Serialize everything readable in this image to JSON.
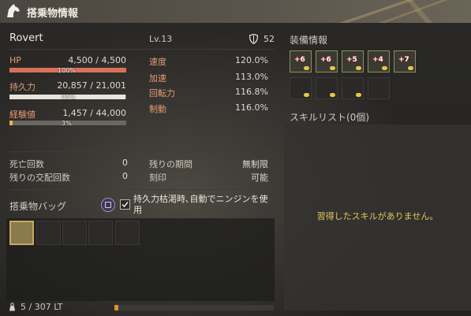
{
  "window": {
    "title": "搭乗物情報"
  },
  "mount": {
    "name": "Rovert",
    "level": "Lv.13",
    "defense": "52"
  },
  "stats": {
    "hp": {
      "label": "HP",
      "value": "4,500 / 4,500",
      "percent_text": "100%",
      "fraction": 1.0,
      "color": "#d9705a"
    },
    "stamina": {
      "label": "持久力",
      "value": "20,857 / 21,001",
      "percent_text": "99%",
      "fraction": 0.99,
      "color": "#e8e4dc"
    },
    "exp": {
      "label": "経験値",
      "value": "1,457 / 44,000",
      "percent_text": "3%",
      "fraction": 0.03,
      "color": "#e6b93c"
    }
  },
  "speed_stats": [
    {
      "label": "速度",
      "value": "120.0%"
    },
    {
      "label": "加速",
      "value": "113.0%"
    },
    {
      "label": "回転力",
      "value": "116.8%"
    },
    {
      "label": "制動",
      "value": "116.0%"
    }
  ],
  "info": {
    "deaths": {
      "label": "死亡回数",
      "value": "0"
    },
    "breeding": {
      "label": "残りの交配回数",
      "value": "0"
    },
    "period": {
      "label": "残りの期間",
      "value": "無制限"
    },
    "engrave": {
      "label": "刻印",
      "value": "可能"
    }
  },
  "bag": {
    "label": "搭乗物バッグ",
    "auto_carrot_text": "持久力枯渇時､自動でニンジンを使用",
    "weight_text": "5 / 307 LT"
  },
  "equipment": {
    "label": "装備情報",
    "slots": [
      "+6",
      "+6",
      "+5",
      "+4",
      "+7"
    ]
  },
  "skills": {
    "header": "スキルリスト(0個)",
    "empty_text": "習得したスキルがありません。"
  }
}
